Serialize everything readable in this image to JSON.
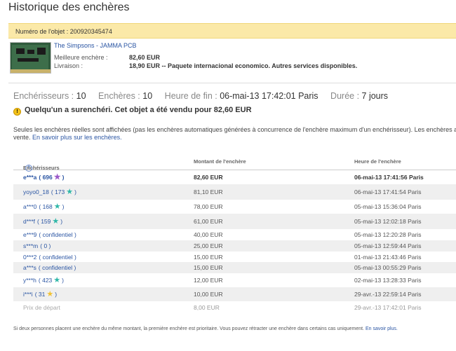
{
  "page": {
    "title": "Historique des enchères"
  },
  "item": {
    "number_label": "Numéro de l'objet : 200920345474",
    "name": "The Simpsons - JAMMA PCB",
    "best_bid_label": "Meilleure enchère :",
    "best_bid_value": "82,60 EUR",
    "shipping_label": "Livraison :",
    "shipping_value": "18,90 EUR -- Paquete internacional economico.  Autres services disponibles."
  },
  "stats": {
    "bidders_label": "Enchérisseurs :",
    "bidders_value": "10",
    "bids_label": "Enchères :",
    "bids_value": "10",
    "end_label": "Heure de fin :",
    "end_value": "06-mai-13 17:42:01 Paris",
    "duration_label": "Durée :",
    "duration_value": "7 jours"
  },
  "alert": {
    "icon": "warning-icon",
    "text": "Quelqu'un a surenchéri. Cet objet a été vendu pour 82,60 EUR"
  },
  "note": {
    "line1": "Seules les enchères réelles sont affichées (pas les enchères automatiques générées à concurrence de l'enchère maximum d'un enchérisseur). Les enchères automatiques",
    "line2_prefix": "vente.",
    "line2_link": "En savoir plus sur les enchères."
  },
  "table": {
    "headers": {
      "bidder": "Enchérisseurs",
      "amount": "Montant de l'enchère",
      "time": "Heure de l'enchère"
    },
    "rows": [
      {
        "bidder": "e***a",
        "rating": "( 696",
        "star": "purple",
        "amount": "82,60 EUR",
        "time": "06-mai-13 17:41:56 Paris"
      },
      {
        "bidder": "yoyo0_18",
        "rating": "( 173",
        "star": "teal",
        "amount": "81,10 EUR",
        "time": "06-mai-13 17:41:54 Paris"
      },
      {
        "bidder": "a***0",
        "rating": "( 168",
        "star": "teal",
        "amount": "78,00 EUR",
        "time": "05-mai-13 15:36:04 Paris"
      },
      {
        "bidder": "d***f",
        "rating": "( 159",
        "star": "teal",
        "amount": "61,00 EUR",
        "time": "05-mai-13 12:02:18 Paris"
      },
      {
        "bidder": "e***9",
        "rating": "( confidentiel )",
        "star": "",
        "amount": "40,00 EUR",
        "time": "05-mai-13 12:20:28 Paris"
      },
      {
        "bidder": "s***m",
        "rating": "( 0 )",
        "star": "",
        "amount": "25,00 EUR",
        "time": "05-mai-13 12:59:44 Paris"
      },
      {
        "bidder": "0***2",
        "rating": "( confidentiel )",
        "star": "",
        "amount": "15,00 EUR",
        "time": "01-mai-13 21:43:46 Paris"
      },
      {
        "bidder": "a***s",
        "rating": "( confidentiel )",
        "star": "",
        "amount": "15,00 EUR",
        "time": "05-mai-13 00:55:29 Paris"
      },
      {
        "bidder": "y***h",
        "rating": "( 423",
        "star": "teal",
        "amount": "12,00 EUR",
        "time": "02-mai-13 13:28:33 Paris"
      },
      {
        "bidder": "i***i",
        "rating": "( 31",
        "star": "yellow",
        "amount": "10,00 EUR",
        "time": "29-avr.-13 22:59:14 Paris"
      }
    ],
    "start_row": {
      "label": "Prix de départ",
      "amount": "8,00 EUR",
      "time": "29-avr.-13 17:42:01 Paris"
    }
  },
  "footer": {
    "text": "Si deux personnes placent une enchère du même montant, la première enchère est prioritaire. Vous pouvez rétracter une enchère dans certains cas uniquement.",
    "link": "En savoir plus."
  },
  "colors": {
    "purple": "#9b59c9",
    "teal": "#2fb7a8",
    "yellow": "#f1c232",
    "accent": "#2a55a3",
    "banner": "#fbe9a8"
  }
}
